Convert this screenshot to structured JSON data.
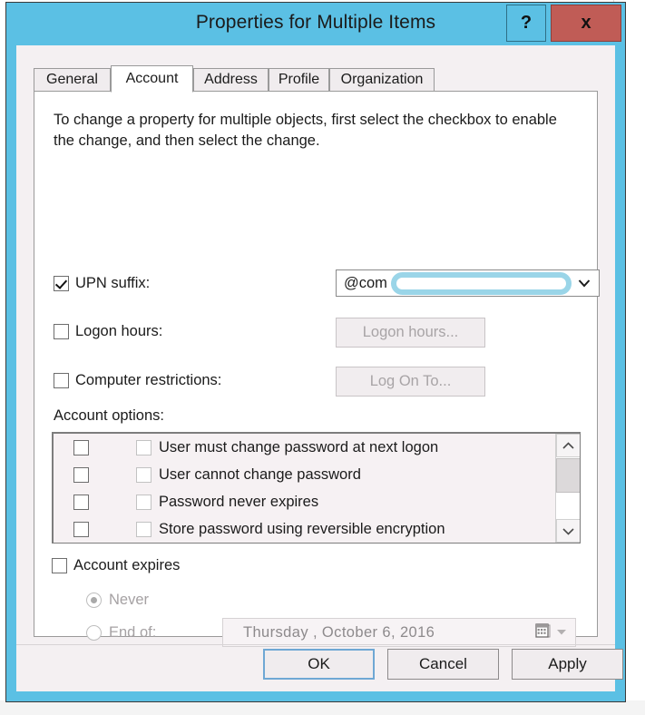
{
  "window": {
    "title": "Properties for Multiple Items",
    "help_label": "?",
    "close_label": "x",
    "frame_color": "#5bc0e4",
    "close_color": "#c05c56"
  },
  "tabs": [
    {
      "label": "General",
      "selected": false
    },
    {
      "label": "Account",
      "selected": true
    },
    {
      "label": "Address",
      "selected": false
    },
    {
      "label": "Profile",
      "selected": false
    },
    {
      "label": "Organization",
      "selected": false
    }
  ],
  "instruction": "To change a property for multiple objects, first select the checkbox to enable the change, and then select the change.",
  "properties": {
    "upn_suffix": {
      "label": "UPN suffix:",
      "checked": true,
      "value": "@com",
      "redacted": true,
      "redaction_color": "#9ad5e8"
    },
    "logon_hours": {
      "label": "Logon hours:",
      "checked": false,
      "button_label": "Logon hours...",
      "button_enabled": false
    },
    "computer_restrictions": {
      "label": "Computer restrictions:",
      "checked": false,
      "button_label": "Log On To...",
      "button_enabled": false
    }
  },
  "account_options": {
    "label": "Account options:",
    "items": [
      {
        "enable_checked": false,
        "value_checked": false,
        "label": "User must change password at next logon"
      },
      {
        "enable_checked": false,
        "value_checked": false,
        "label": "User cannot change password"
      },
      {
        "enable_checked": false,
        "value_checked": false,
        "label": "Password never expires"
      },
      {
        "enable_checked": false,
        "value_checked": false,
        "label": "Store password using reversible encryption"
      }
    ]
  },
  "account_expires": {
    "label": "Account expires",
    "checked": false,
    "never": {
      "label": "Never",
      "selected": true
    },
    "end_of": {
      "label": "End of:",
      "selected": false
    },
    "date_value": "Thursday  ,  October     6, 2016"
  },
  "buttons": {
    "ok": "OK",
    "cancel": "Cancel",
    "apply": "Apply"
  }
}
